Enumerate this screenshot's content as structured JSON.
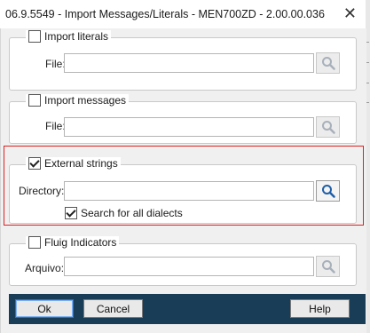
{
  "window": {
    "title": "06.9.5549 - Import Messages/Literals - MEN700ZD - 2.00.00.036",
    "close_glyph": "✕"
  },
  "groups": {
    "literals": {
      "checkbox_label": "Import literals",
      "checked": false,
      "field_label": "File:",
      "value": ""
    },
    "messages": {
      "checkbox_label": "Import messages",
      "checked": false,
      "field_label": "File:",
      "value": ""
    },
    "external": {
      "checkbox_label": "External strings",
      "checked": true,
      "field_label": "Directory:",
      "value": "",
      "option_label": "Search for all dialects",
      "option_checked": true
    },
    "fluig": {
      "checkbox_label": "Fluig Indicators",
      "checked": false,
      "field_label": "Arquivo:",
      "value": ""
    }
  },
  "buttons": {
    "ok": "Ok",
    "cancel": "Cancel",
    "help": "Help"
  },
  "colors": {
    "footer": "#1a3d57",
    "highlight": "#dd2222",
    "search_active": "#1f5fa8",
    "search_inactive": "#a8b0ba"
  },
  "icons": {
    "search": "magnifier-icon"
  }
}
